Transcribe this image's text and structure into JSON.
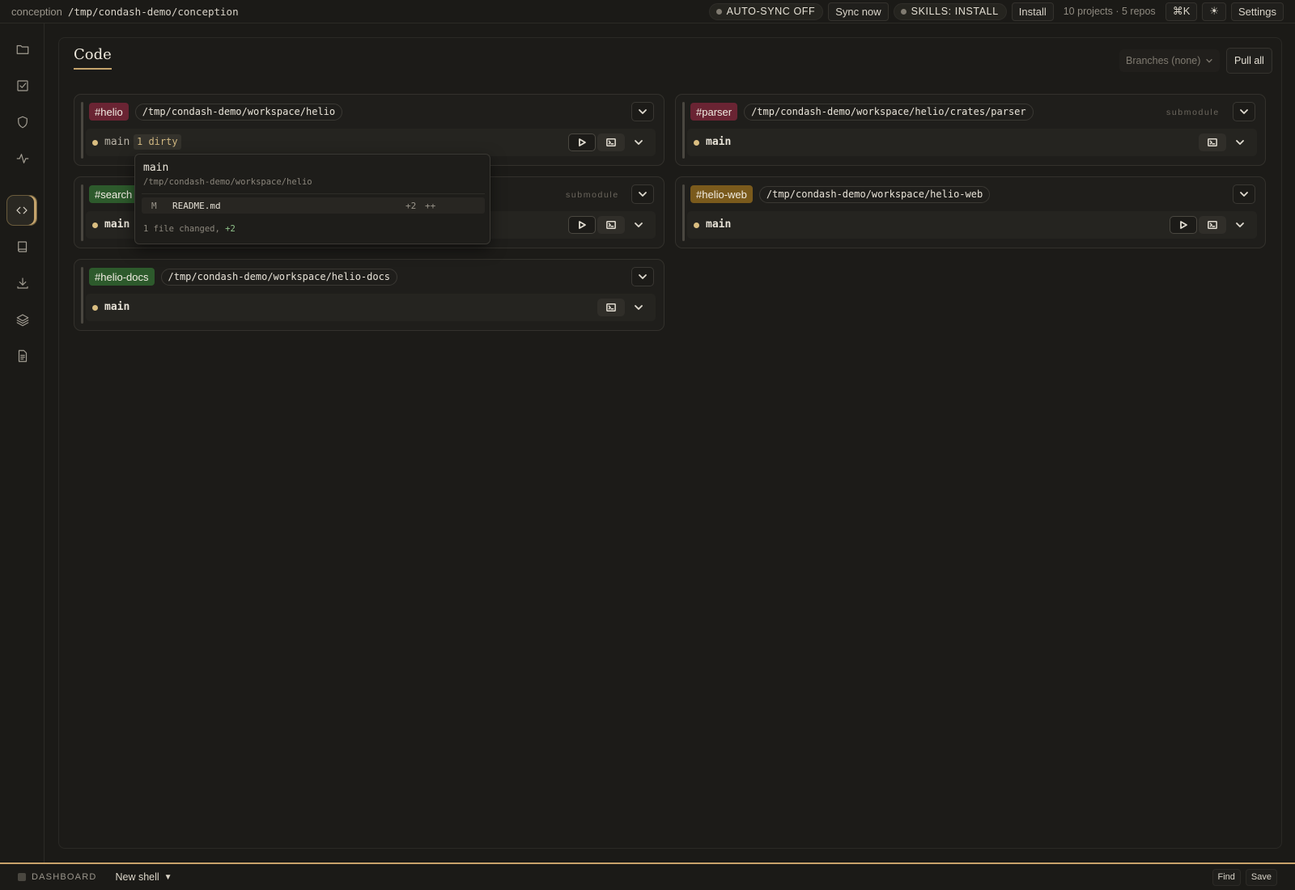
{
  "topbar": {
    "app_name": "conception",
    "path": "/tmp/condash-demo/conception",
    "autosync_label": "AUTO-SYNC OFF",
    "sync_now_label": "Sync now",
    "skills_label": "SKILLS: INSTALL",
    "install_label": "Install",
    "summary": "10 projects · 5 repos",
    "shortcut_label": "⌘K",
    "theme_icon": "☀",
    "settings_label": "Settings"
  },
  "sidebar": {
    "items": [
      {
        "name": "folder",
        "active": false
      },
      {
        "name": "checklist",
        "active": false
      },
      {
        "name": "shield",
        "active": false
      },
      {
        "name": "activity",
        "active": false
      },
      {
        "name": "code",
        "active": true
      },
      {
        "name": "book",
        "active": false
      },
      {
        "name": "download",
        "active": false
      },
      {
        "name": "layers",
        "active": false
      },
      {
        "name": "document",
        "active": false
      }
    ]
  },
  "main": {
    "title": "Code",
    "branches_label": "Branches (none)",
    "pull_all_label": "Pull all"
  },
  "repos": [
    {
      "tag": "#helio",
      "path": "/tmp/condash-demo/workspace/helio",
      "submodule": "",
      "branch": "main",
      "dirty": "1 dirty"
    },
    {
      "tag": "#parser",
      "path": "/tmp/condash-demo/workspace/helio/crates/parser",
      "submodule": "submodule",
      "branch": "main"
    },
    {
      "tag": "#search",
      "path": "",
      "submodule": "submodule",
      "branch": "main"
    },
    {
      "tag": "#helio-web",
      "path": "/tmp/condash-demo/workspace/helio-web",
      "submodule": "",
      "branch": "main"
    },
    {
      "tag": "#helio-docs",
      "path": "/tmp/condash-demo/workspace/helio-docs",
      "submodule": "",
      "branch": "main"
    }
  ],
  "popover": {
    "branch": "main",
    "path": "/tmp/condash-demo/workspace/helio",
    "files": [
      {
        "status": "M",
        "name": "README.md",
        "additions": "+2",
        "bar": "++"
      }
    ],
    "summary_prefix": "1 file changed, ",
    "summary_plus": "+2"
  },
  "bottombar": {
    "dashboard_label": "DASHBOARD",
    "shell_label": "New shell",
    "shell_caret": "▼",
    "find_label": "Find",
    "save_label": "Save"
  },
  "colors": {
    "accent": "#c5a46c",
    "tag_red": "#6a2433",
    "tag_green": "#2d5a2c",
    "tag_amber": "#7a5a1c",
    "branch_dot": "#d9bd80"
  }
}
